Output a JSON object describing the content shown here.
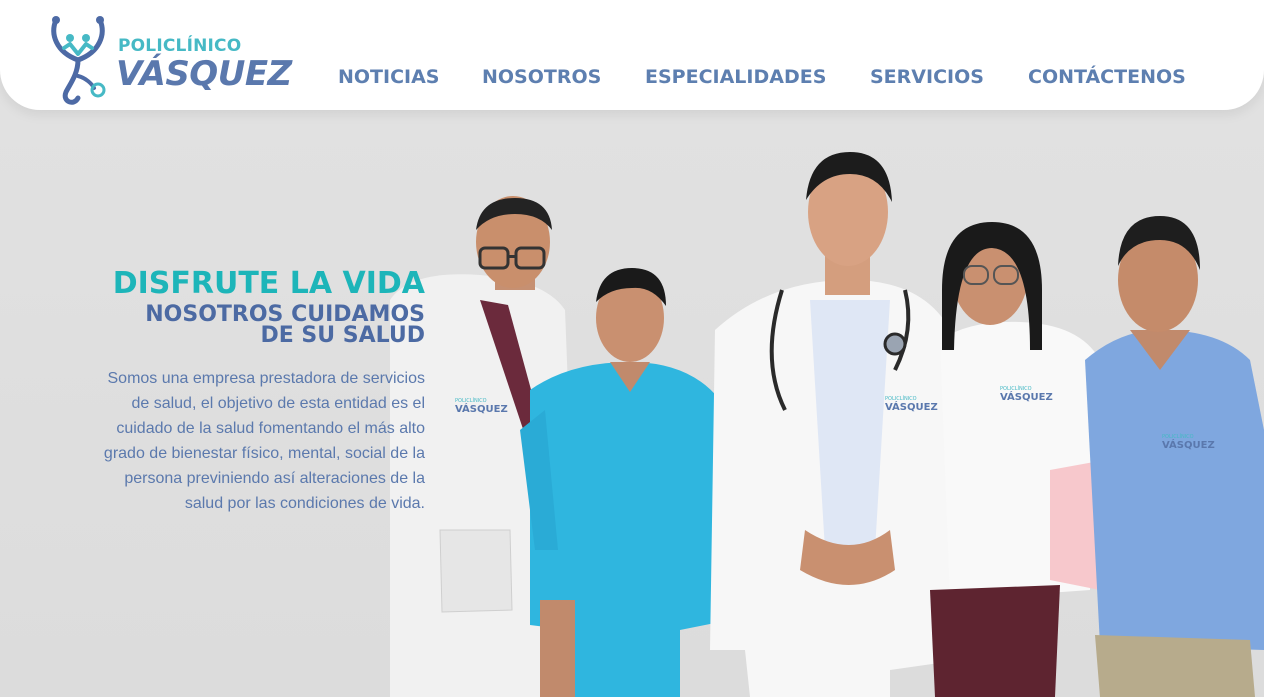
{
  "brand": {
    "top": "POLICLÍNICO",
    "main": "VÁSQUEZ"
  },
  "nav": {
    "items": [
      "NOTICIAS",
      "NOSOTROS",
      "ESPECIALIDADES",
      "SERVICIOS",
      "CONTÁCTENOS"
    ]
  },
  "hero": {
    "title": "DISFRUTE LA VIDA",
    "subtitle_line1": "NOSOTROS CUIDAMOS",
    "subtitle_line2": "DE SU SALUD",
    "description": "Somos una empresa prestadora de servicios de salud, el objetivo de esta entidad es el cuidado de la salud fomentando el más alto grado de bienestar físico, mental, social de la persona previniendo así alteraciones de la salud por las condiciones de vida."
  },
  "uniform_logo": {
    "top": "POLICLÍNICO",
    "main": "VÁSQUEZ"
  },
  "colors": {
    "accent_teal": "#1db5b9",
    "brand_blue": "#5a78ad",
    "background": "#dedede"
  }
}
